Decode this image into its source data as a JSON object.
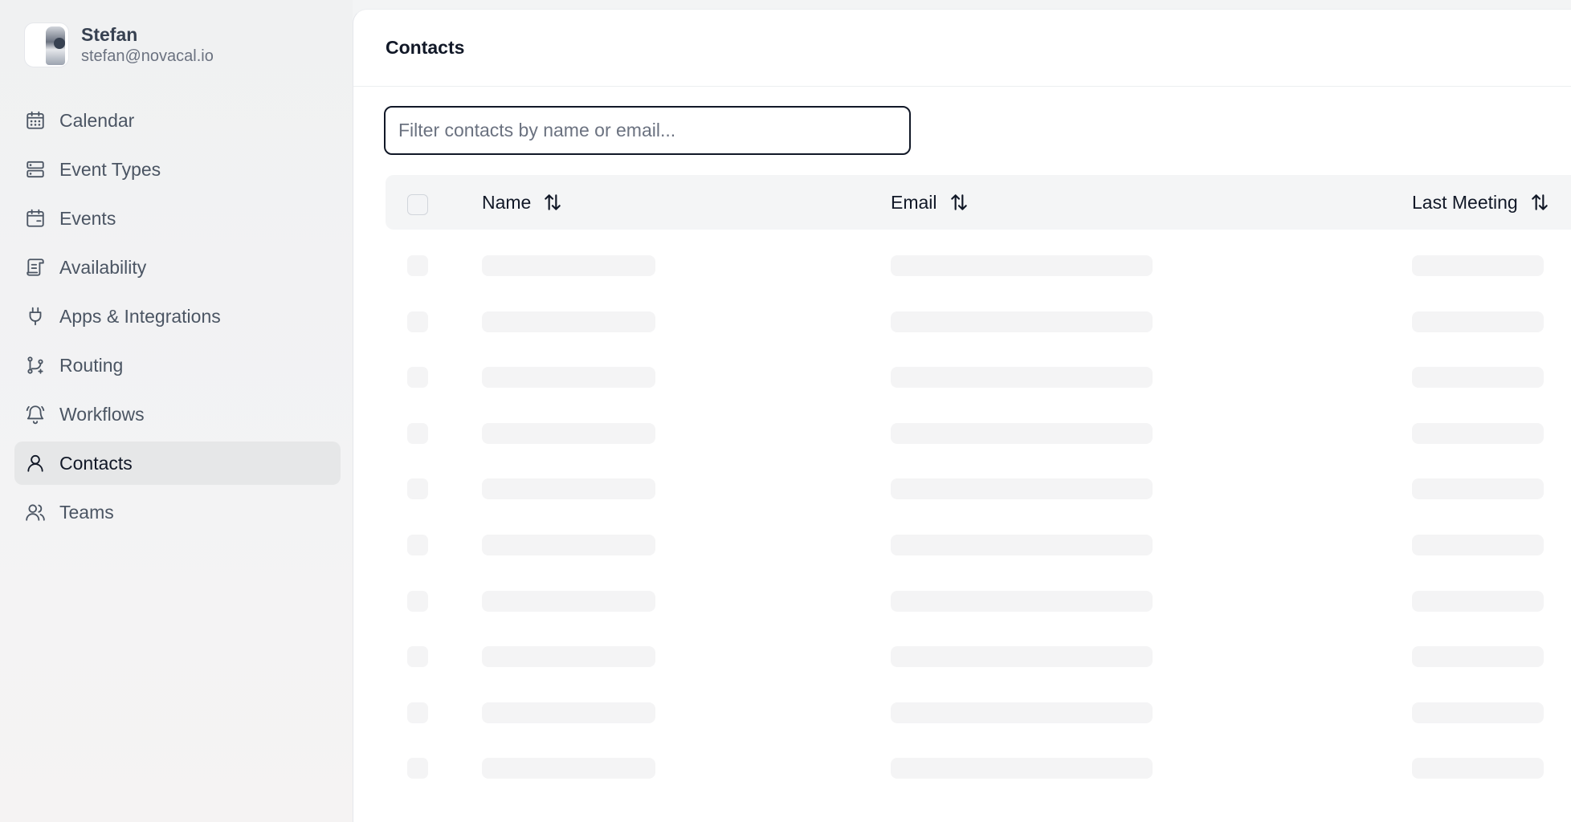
{
  "user": {
    "name": "Stefan",
    "email": "stefan@novacal.io"
  },
  "nav": [
    {
      "label": "Calendar",
      "icon": "calendar-icon"
    },
    {
      "label": "Event Types",
      "icon": "event-types-icon"
    },
    {
      "label": "Events",
      "icon": "events-icon"
    },
    {
      "label": "Availability",
      "icon": "availability-icon"
    },
    {
      "label": "Apps & Integrations",
      "icon": "plug-icon"
    },
    {
      "label": "Routing",
      "icon": "routing-icon"
    },
    {
      "label": "Workflows",
      "icon": "bell-icon"
    },
    {
      "label": "Contacts",
      "icon": "user-icon",
      "active": true
    },
    {
      "label": "Teams",
      "icon": "users-icon"
    }
  ],
  "page": {
    "title": "Contacts"
  },
  "filter": {
    "placeholder": "Filter contacts by name or email...",
    "value": ""
  },
  "table": {
    "columns": [
      {
        "label": "Name",
        "sort_icon": "sort-arrows-icon"
      },
      {
        "label": "Email",
        "sort_icon": "sort-arrows-icon"
      },
      {
        "label": "Last Meeting",
        "sort_icon": "sort-arrows-icon"
      }
    ],
    "loading_rows": 10
  },
  "colors": {
    "sidebar_bg": "#f0f1f2",
    "active_item_bg": "#e6e7e8",
    "skeleton": "#f4f4f5",
    "text_primary": "#111827",
    "text_muted": "#6b7280"
  }
}
